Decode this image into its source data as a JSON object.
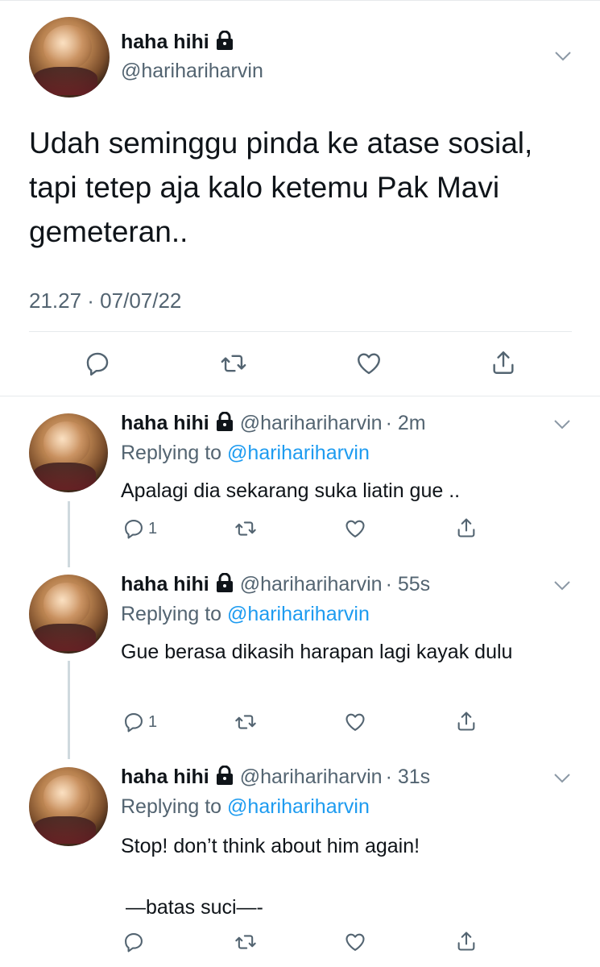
{
  "main_tweet": {
    "name": "haha hihi",
    "handle": "@harihariharvin",
    "text": "Udah seminggu pinda ke atase sosial, tapi tetep aja kalo ketemu Pak Mavi gemeteran..",
    "timestamp": "21.27 · 07/07/22"
  },
  "replies": [
    {
      "name": "haha hihi",
      "handle": "@harihariharvin",
      "time": "· 2m",
      "replying_label": "Replying to",
      "replying_to": "@harihariharvin",
      "text": "Apalagi dia sekarang suka liatin gue ..",
      "reply_count": "1"
    },
    {
      "name": "haha hihi",
      "handle": "@harihariharvin",
      "time": "· 55s",
      "replying_label": "Replying to",
      "replying_to": "@harihariharvin",
      "text": "Gue berasa dikasih harapan lagi kayak dulu",
      "reply_count": "1"
    },
    {
      "name": "haha hihi",
      "handle": "@harihariharvin",
      "time": "· 31s",
      "replying_label": "Replying to",
      "replying_to": "@harihariharvin",
      "text_line1": "Stop! don’t think about him again!",
      "text_line2": "—batas suci—-"
    }
  ],
  "icons": {
    "reply": "reply-icon",
    "retweet": "retweet-icon",
    "like": "heart-icon",
    "share": "share-icon",
    "more": "chevron-down-icon",
    "lock": "lock-icon"
  },
  "colors": {
    "text": "#0f1419",
    "secondary": "#536471",
    "link": "#1d9bf0",
    "divider": "#e6e9ec"
  }
}
